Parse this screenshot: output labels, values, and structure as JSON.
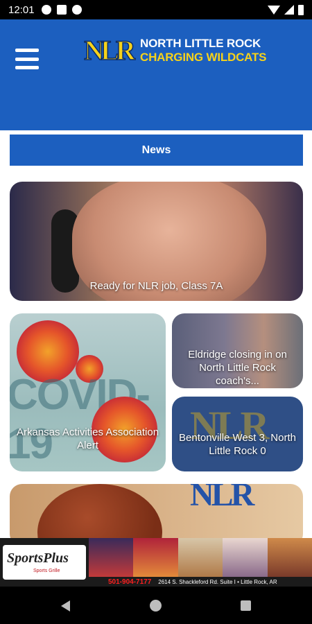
{
  "status_bar": {
    "time": "12:01",
    "icons": [
      "a-icon",
      "sim-icon",
      "data-saver-icon",
      "wifi-icon",
      "signal-icon",
      "battery-icon"
    ]
  },
  "header": {
    "logo_text": "NLR",
    "team_name_line1": "NORTH LITTLE ROCK",
    "team_name_line2": "CHARGING WILDCATS",
    "menu_icon": "hamburger-menu-icon",
    "colors": {
      "primary": "#1c5fbf",
      "accent": "#f6d21a"
    }
  },
  "news_section": {
    "label": "News"
  },
  "news_cards": [
    {
      "caption": "Ready for NLR job, Class 7A"
    },
    {
      "caption": "Arkansas Activities Association Alert",
      "image_text": "COVID-19"
    },
    {
      "caption": "Eldridge closing in on North Little Rock coach's..."
    },
    {
      "caption": "Bentonville West 3, North Little Rock 0",
      "image_text": "NLR"
    },
    {
      "caption": "",
      "image_text": "NLR"
    }
  ],
  "ad_banner": {
    "brand": "SportsPlus",
    "tagline": "Sports Grille",
    "phone": "501-904-7177",
    "address": "2614 S. Shackleford Rd. Suite I • Little Rock, AR"
  },
  "nav_bar": {
    "icons": [
      "back-icon",
      "home-icon",
      "recents-icon"
    ]
  }
}
